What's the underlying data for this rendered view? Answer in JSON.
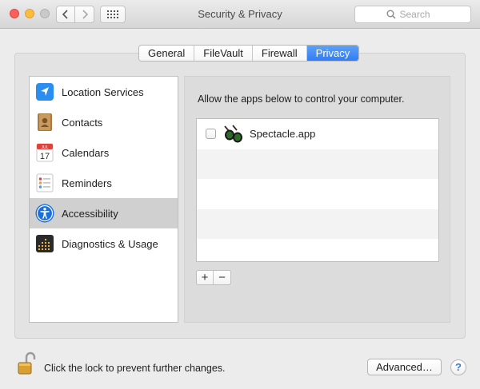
{
  "window": {
    "title": "Security & Privacy",
    "search_placeholder": "Search"
  },
  "tabs": [
    {
      "label": "General",
      "active": false
    },
    {
      "label": "FileVault",
      "active": false
    },
    {
      "label": "Firewall",
      "active": false
    },
    {
      "label": "Privacy",
      "active": true
    }
  ],
  "sidebar": {
    "items": [
      {
        "label": "Location Services",
        "icon": "location-arrow-icon",
        "selected": false
      },
      {
        "label": "Contacts",
        "icon": "contacts-book-icon",
        "selected": false
      },
      {
        "label": "Calendars",
        "icon": "calendar-icon",
        "selected": false,
        "icon_text_month": "JUL",
        "icon_text_day": "17"
      },
      {
        "label": "Reminders",
        "icon": "reminders-list-icon",
        "selected": false
      },
      {
        "label": "Accessibility",
        "icon": "accessibility-icon",
        "selected": true
      },
      {
        "label": "Diagnostics & Usage",
        "icon": "diagnostics-icon",
        "selected": false
      }
    ]
  },
  "content": {
    "instruction": "Allow the apps below to control your computer.",
    "apps": [
      {
        "name": "Spectacle.app",
        "checked": false,
        "icon": "glasses-icon"
      }
    ],
    "add_label": "+",
    "remove_label": "−"
  },
  "footer": {
    "lock_text": "Click the lock to prevent further changes.",
    "advanced_label": "Advanced…",
    "help_label": "?"
  },
  "colors": {
    "accent": "#2f7cf5",
    "selection": "#d0d0d0",
    "panel": "#e3e3e3"
  }
}
